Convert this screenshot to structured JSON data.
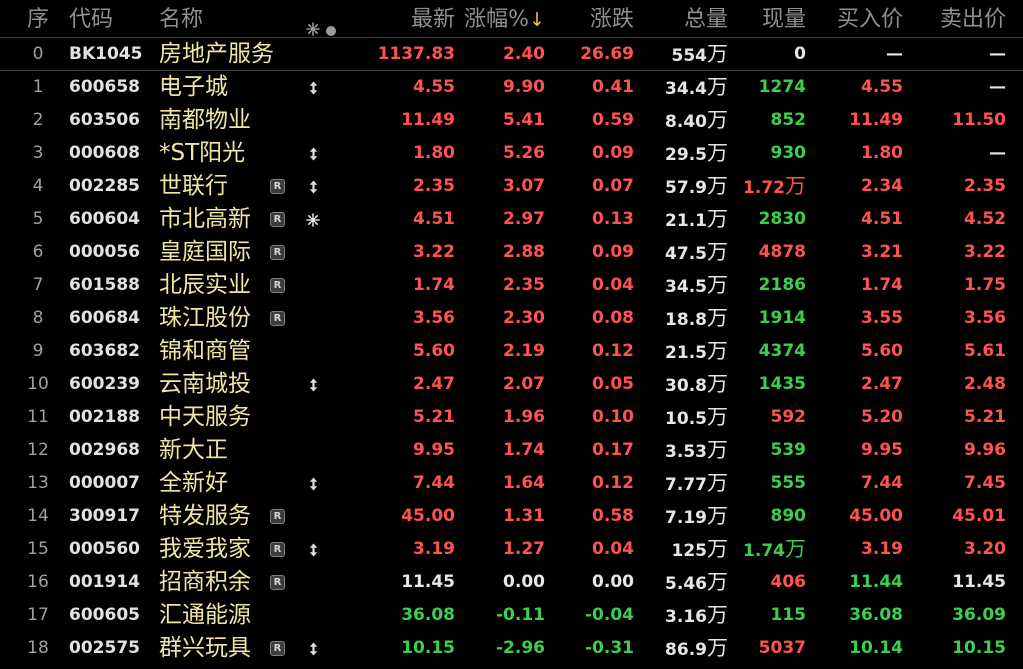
{
  "table": {
    "columns": {
      "seq": "序",
      "code": "代码",
      "name": "名称",
      "last": "最新",
      "pct": "涨幅%",
      "pct_sort": "↓",
      "chg": "涨跌",
      "vol": "总量",
      "cur": "现量",
      "bid": "买入价",
      "ask": "卖出价"
    },
    "flag_header_icons": [
      "sun-icon",
      "dot-icon"
    ],
    "rows": [
      {
        "seq": "0",
        "code": "BK1045",
        "name": "房地产服务",
        "last": {
          "text": "1137.83",
          "color": "#ff5252"
        },
        "pct": {
          "text": "2.40",
          "color": "#ff5252"
        },
        "chg": {
          "text": "26.69",
          "color": "#ff5252"
        },
        "vol": {
          "text": "554万",
          "color": "#e6e6e6"
        },
        "cur": {
          "text": "0",
          "color": "#e6e6e6"
        },
        "bid": {
          "text": "—",
          "color": "#e6e6e6"
        },
        "ask": {
          "text": "—",
          "color": "#e6e6e6"
        }
      },
      {
        "seq": "1",
        "code": "600658",
        "name": "电子城",
        "icon": "up-down-arrow-icon",
        "last": {
          "text": "4.55",
          "color": "#ff5252"
        },
        "pct": {
          "text": "9.90",
          "color": "#ff5252"
        },
        "chg": {
          "text": "0.41",
          "color": "#ff5252"
        },
        "vol": {
          "text": "34.4万",
          "color": "#e6e6e6"
        },
        "cur": {
          "text": "1274",
          "color": "#3ccf4e"
        },
        "bid": {
          "text": "4.55",
          "color": "#ff5252"
        },
        "ask": {
          "text": "—",
          "color": "#e6e6e6"
        }
      },
      {
        "seq": "2",
        "code": "603506",
        "name": "南都物业",
        "last": {
          "text": "11.49",
          "color": "#ff5252"
        },
        "pct": {
          "text": "5.41",
          "color": "#ff5252"
        },
        "chg": {
          "text": "0.59",
          "color": "#ff5252"
        },
        "vol": {
          "text": "8.40万",
          "color": "#e6e6e6"
        },
        "cur": {
          "text": "852",
          "color": "#3ccf4e"
        },
        "bid": {
          "text": "11.49",
          "color": "#ff5252"
        },
        "ask": {
          "text": "11.50",
          "color": "#ff5252"
        }
      },
      {
        "seq": "3",
        "code": "000608",
        "name": "*ST阳光",
        "icon": "up-down-arrow-icon",
        "last": {
          "text": "1.80",
          "color": "#ff5252"
        },
        "pct": {
          "text": "5.26",
          "color": "#ff5252"
        },
        "chg": {
          "text": "0.09",
          "color": "#ff5252"
        },
        "vol": {
          "text": "29.5万",
          "color": "#e6e6e6"
        },
        "cur": {
          "text": "930",
          "color": "#3ccf4e"
        },
        "bid": {
          "text": "1.80",
          "color": "#ff5252"
        },
        "ask": {
          "text": "—",
          "color": "#e6e6e6"
        }
      },
      {
        "seq": "4",
        "code": "002285",
        "name": "世联行",
        "badge": "R",
        "icon": "up-down-arrow-icon",
        "last": {
          "text": "2.35",
          "color": "#ff5252"
        },
        "pct": {
          "text": "3.07",
          "color": "#ff5252"
        },
        "chg": {
          "text": "0.07",
          "color": "#ff5252"
        },
        "vol": {
          "text": "57.9万",
          "color": "#e6e6e6"
        },
        "cur": {
          "text": "1.72万",
          "color": "#ff5252"
        },
        "bid": {
          "text": "2.34",
          "color": "#ff5252"
        },
        "ask": {
          "text": "2.35",
          "color": "#ff5252"
        }
      },
      {
        "seq": "5",
        "code": "600604",
        "name": "市北高新",
        "badge": "R",
        "icon": "sun-icon",
        "last": {
          "text": "4.51",
          "color": "#ff5252"
        },
        "pct": {
          "text": "2.97",
          "color": "#ff5252"
        },
        "chg": {
          "text": "0.13",
          "color": "#ff5252"
        },
        "vol": {
          "text": "21.1万",
          "color": "#e6e6e6"
        },
        "cur": {
          "text": "2830",
          "color": "#3ccf4e"
        },
        "bid": {
          "text": "4.51",
          "color": "#ff5252"
        },
        "ask": {
          "text": "4.52",
          "color": "#ff5252"
        }
      },
      {
        "seq": "6",
        "code": "000056",
        "name": "皇庭国际",
        "badge": "R",
        "last": {
          "text": "3.22",
          "color": "#ff5252"
        },
        "pct": {
          "text": "2.88",
          "color": "#ff5252"
        },
        "chg": {
          "text": "0.09",
          "color": "#ff5252"
        },
        "vol": {
          "text": "47.5万",
          "color": "#e6e6e6"
        },
        "cur": {
          "text": "4878",
          "color": "#ff5252"
        },
        "bid": {
          "text": "3.21",
          "color": "#ff5252"
        },
        "ask": {
          "text": "3.22",
          "color": "#ff5252"
        }
      },
      {
        "seq": "7",
        "code": "601588",
        "name": "北辰实业",
        "badge": "R",
        "last": {
          "text": "1.74",
          "color": "#ff5252"
        },
        "pct": {
          "text": "2.35",
          "color": "#ff5252"
        },
        "chg": {
          "text": "0.04",
          "color": "#ff5252"
        },
        "vol": {
          "text": "34.5万",
          "color": "#e6e6e6"
        },
        "cur": {
          "text": "2186",
          "color": "#3ccf4e"
        },
        "bid": {
          "text": "1.74",
          "color": "#ff5252"
        },
        "ask": {
          "text": "1.75",
          "color": "#ff5252"
        }
      },
      {
        "seq": "8",
        "code": "600684",
        "name": "珠江股份",
        "badge": "R",
        "last": {
          "text": "3.56",
          "color": "#ff5252"
        },
        "pct": {
          "text": "2.30",
          "color": "#ff5252"
        },
        "chg": {
          "text": "0.08",
          "color": "#ff5252"
        },
        "vol": {
          "text": "18.8万",
          "color": "#e6e6e6"
        },
        "cur": {
          "text": "1914",
          "color": "#3ccf4e"
        },
        "bid": {
          "text": "3.55",
          "color": "#ff5252"
        },
        "ask": {
          "text": "3.56",
          "color": "#ff5252"
        }
      },
      {
        "seq": "9",
        "code": "603682",
        "name": "锦和商管",
        "last": {
          "text": "5.60",
          "color": "#ff5252"
        },
        "pct": {
          "text": "2.19",
          "color": "#ff5252"
        },
        "chg": {
          "text": "0.12",
          "color": "#ff5252"
        },
        "vol": {
          "text": "21.5万",
          "color": "#e6e6e6"
        },
        "cur": {
          "text": "4374",
          "color": "#3ccf4e"
        },
        "bid": {
          "text": "5.60",
          "color": "#ff5252"
        },
        "ask": {
          "text": "5.61",
          "color": "#ff5252"
        }
      },
      {
        "seq": "10",
        "code": "600239",
        "name": "云南城投",
        "icon": "up-down-arrow-icon",
        "last": {
          "text": "2.47",
          "color": "#ff5252"
        },
        "pct": {
          "text": "2.07",
          "color": "#ff5252"
        },
        "chg": {
          "text": "0.05",
          "color": "#ff5252"
        },
        "vol": {
          "text": "30.8万",
          "color": "#e6e6e6"
        },
        "cur": {
          "text": "1435",
          "color": "#3ccf4e"
        },
        "bid": {
          "text": "2.47",
          "color": "#ff5252"
        },
        "ask": {
          "text": "2.48",
          "color": "#ff5252"
        }
      },
      {
        "seq": "11",
        "code": "002188",
        "name": "中天服务",
        "last": {
          "text": "5.21",
          "color": "#ff5252"
        },
        "pct": {
          "text": "1.96",
          "color": "#ff5252"
        },
        "chg": {
          "text": "0.10",
          "color": "#ff5252"
        },
        "vol": {
          "text": "10.5万",
          "color": "#e6e6e6"
        },
        "cur": {
          "text": "592",
          "color": "#ff5252"
        },
        "bid": {
          "text": "5.20",
          "color": "#ff5252"
        },
        "ask": {
          "text": "5.21",
          "color": "#ff5252"
        }
      },
      {
        "seq": "12",
        "code": "002968",
        "name": "新大正",
        "last": {
          "text": "9.95",
          "color": "#ff5252"
        },
        "pct": {
          "text": "1.74",
          "color": "#ff5252"
        },
        "chg": {
          "text": "0.17",
          "color": "#ff5252"
        },
        "vol": {
          "text": "3.53万",
          "color": "#e6e6e6"
        },
        "cur": {
          "text": "539",
          "color": "#3ccf4e"
        },
        "bid": {
          "text": "9.95",
          "color": "#ff5252"
        },
        "ask": {
          "text": "9.96",
          "color": "#ff5252"
        }
      },
      {
        "seq": "13",
        "code": "000007",
        "name": "全新好",
        "icon": "up-down-arrow-icon",
        "last": {
          "text": "7.44",
          "color": "#ff5252"
        },
        "pct": {
          "text": "1.64",
          "color": "#ff5252"
        },
        "chg": {
          "text": "0.12",
          "color": "#ff5252"
        },
        "vol": {
          "text": "7.77万",
          "color": "#e6e6e6"
        },
        "cur": {
          "text": "555",
          "color": "#3ccf4e"
        },
        "bid": {
          "text": "7.44",
          "color": "#ff5252"
        },
        "ask": {
          "text": "7.45",
          "color": "#ff5252"
        }
      },
      {
        "seq": "14",
        "code": "300917",
        "name": "特发服务",
        "badge": "R",
        "last": {
          "text": "45.00",
          "color": "#ff5252"
        },
        "pct": {
          "text": "1.31",
          "color": "#ff5252"
        },
        "chg": {
          "text": "0.58",
          "color": "#ff5252"
        },
        "vol": {
          "text": "7.19万",
          "color": "#e6e6e6"
        },
        "cur": {
          "text": "890",
          "color": "#3ccf4e"
        },
        "bid": {
          "text": "45.00",
          "color": "#ff5252"
        },
        "ask": {
          "text": "45.01",
          "color": "#ff5252"
        }
      },
      {
        "seq": "15",
        "code": "000560",
        "name": "我爱我家",
        "badge": "R",
        "icon": "up-down-arrow-icon",
        "last": {
          "text": "3.19",
          "color": "#ff5252"
        },
        "pct": {
          "text": "1.27",
          "color": "#ff5252"
        },
        "chg": {
          "text": "0.04",
          "color": "#ff5252"
        },
        "vol": {
          "text": "125万",
          "color": "#e6e6e6"
        },
        "cur": {
          "text": "1.74万",
          "color": "#3ccf4e"
        },
        "bid": {
          "text": "3.19",
          "color": "#ff5252"
        },
        "ask": {
          "text": "3.20",
          "color": "#ff5252"
        }
      },
      {
        "seq": "16",
        "code": "001914",
        "name": "招商积余",
        "badge": "R",
        "last": {
          "text": "11.45",
          "color": "#e6e6e6"
        },
        "pct": {
          "text": "0.00",
          "color": "#e6e6e6"
        },
        "chg": {
          "text": "0.00",
          "color": "#e6e6e6"
        },
        "vol": {
          "text": "5.46万",
          "color": "#e6e6e6"
        },
        "cur": {
          "text": "406",
          "color": "#ff5252"
        },
        "bid": {
          "text": "11.44",
          "color": "#3ccf4e"
        },
        "ask": {
          "text": "11.45",
          "color": "#e6e6e6"
        }
      },
      {
        "seq": "17",
        "code": "600605",
        "name": "汇通能源",
        "last": {
          "text": "36.08",
          "color": "#3ccf4e"
        },
        "pct": {
          "text": "-0.11",
          "color": "#3ccf4e"
        },
        "chg": {
          "text": "-0.04",
          "color": "#3ccf4e"
        },
        "vol": {
          "text": "3.16万",
          "color": "#e6e6e6"
        },
        "cur": {
          "text": "115",
          "color": "#3ccf4e"
        },
        "bid": {
          "text": "36.08",
          "color": "#3ccf4e"
        },
        "ask": {
          "text": "36.09",
          "color": "#3ccf4e"
        }
      },
      {
        "seq": "18",
        "code": "002575",
        "name": "群兴玩具",
        "badge": "R",
        "icon": "up-down-arrow-icon",
        "last": {
          "text": "10.15",
          "color": "#3ccf4e"
        },
        "pct": {
          "text": "-2.96",
          "color": "#3ccf4e"
        },
        "chg": {
          "text": "-0.31",
          "color": "#3ccf4e"
        },
        "vol": {
          "text": "86.9万",
          "color": "#e6e6e6"
        },
        "cur": {
          "text": "5037",
          "color": "#ff5252"
        },
        "bid": {
          "text": "10.14",
          "color": "#3ccf4e"
        },
        "ask": {
          "text": "10.15",
          "color": "#3ccf4e"
        }
      }
    ]
  },
  "colors": {
    "background": "#000000",
    "header_text": "#8f8f8f",
    "separator": "#3a3a3a",
    "index_text": "#a0a0a0",
    "code_text": "#e2e2e2",
    "name_text": "#efe6a6",
    "rise": "#ff5252",
    "fall": "#3ccf4e",
    "neutral": "#e6e6e6",
    "sort_indicator": "#f0bf2e"
  }
}
